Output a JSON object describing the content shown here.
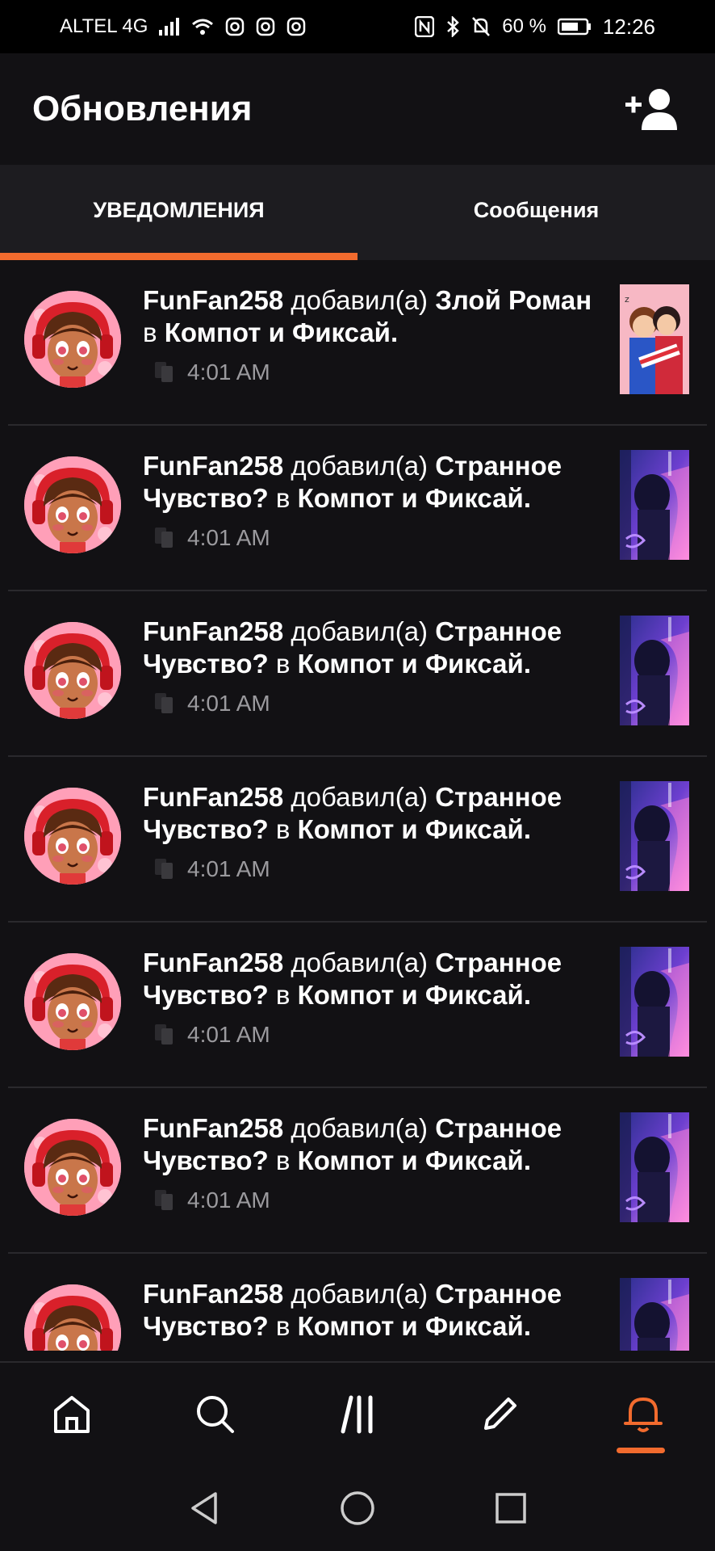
{
  "status_bar": {
    "carrier": "ALTEL 4G",
    "battery": "60 %",
    "time": "12:26",
    "icons": [
      "signal-icon",
      "wifi-icon",
      "instagram-icon",
      "instagram-icon",
      "instagram-icon",
      "nfc-icon",
      "bluetooth-icon",
      "mute-icon",
      "battery-icon"
    ]
  },
  "header": {
    "title": "Обновления",
    "action_icon": "add-user-icon"
  },
  "tabs": [
    {
      "label": "УВЕДОМЛЕНИЯ",
      "active": true
    },
    {
      "label": "Сообщения",
      "active": false
    }
  ],
  "notifications": [
    {
      "user": "FunFan258",
      "verb": "добавил(а)",
      "story": "Злой Роман",
      "prep": "в",
      "book": "Компот и Фиксай.",
      "time": "4:01 AM",
      "thumb": "thumb-a"
    },
    {
      "user": "FunFan258",
      "verb": "добавил(а)",
      "story": "Странное Чувство?",
      "prep": "в",
      "book": "Компот и Фиксай.",
      "time": "4:01 AM",
      "thumb": "thumb-b"
    },
    {
      "user": "FunFan258",
      "verb": "добавил(а)",
      "story": "Странное Чувство?",
      "prep": "в",
      "book": "Компот и Фиксай.",
      "time": "4:01 AM",
      "thumb": "thumb-b"
    },
    {
      "user": "FunFan258",
      "verb": "добавил(а)",
      "story": "Странное Чувство?",
      "prep": "в",
      "book": "Компот и Фиксай.",
      "time": "4:01 AM",
      "thumb": "thumb-b"
    },
    {
      "user": "FunFan258",
      "verb": "добавил(а)",
      "story": "Странное Чувство?",
      "prep": "в",
      "book": "Компот и Фиксай.",
      "time": "4:01 AM",
      "thumb": "thumb-b"
    },
    {
      "user": "FunFan258",
      "verb": "добавил(а)",
      "story": "Странное Чувство?",
      "prep": "в",
      "book": "Компот и Фиксай.",
      "time": "4:01 AM",
      "thumb": "thumb-b"
    },
    {
      "user": "FunFan258",
      "verb": "добавил(а)",
      "story": "Странное Чувство?",
      "prep": "в",
      "book": "Компот и Фиксай.",
      "time": "",
      "thumb": "thumb-b"
    }
  ],
  "bottom_nav": [
    {
      "icon": "home-icon",
      "active": false
    },
    {
      "icon": "search-icon",
      "active": false
    },
    {
      "icon": "library-icon",
      "active": false
    },
    {
      "icon": "pencil-icon",
      "active": false
    },
    {
      "icon": "bell-icon",
      "active": true
    }
  ],
  "system_nav": [
    "back-icon",
    "home-circle-icon",
    "recents-icon"
  ],
  "colors": {
    "accent": "#f26b2e",
    "background": "#121114",
    "tabs_bg": "#1d1c20",
    "muted_text": "#9b9a9e"
  }
}
